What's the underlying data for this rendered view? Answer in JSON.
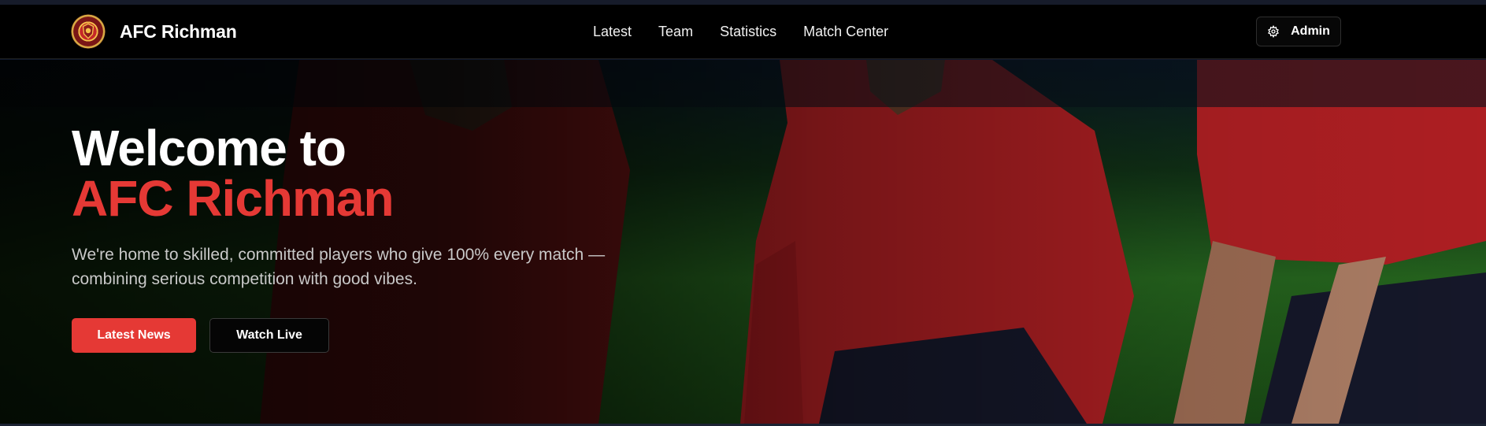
{
  "brand": {
    "name": "AFC Richman",
    "logo_icon": "club-crest-icon"
  },
  "nav": {
    "links": [
      "Latest",
      "Team",
      "Statistics",
      "Match Center"
    ],
    "admin_label": "Admin",
    "admin_icon": "gear-icon"
  },
  "hero": {
    "title_line1": "Welcome to",
    "title_line2": "AFC Richman",
    "description": "We're home to skilled, committed players who give 100% every match — combining serious competition with good vibes.",
    "primary_button": "Latest News",
    "secondary_button": "Watch Live",
    "background": "football-players-photo"
  },
  "colors": {
    "accent": "#e53935",
    "nav_bg": "#000000",
    "text": "#ffffff",
    "muted_text": "#c9c9c9"
  }
}
